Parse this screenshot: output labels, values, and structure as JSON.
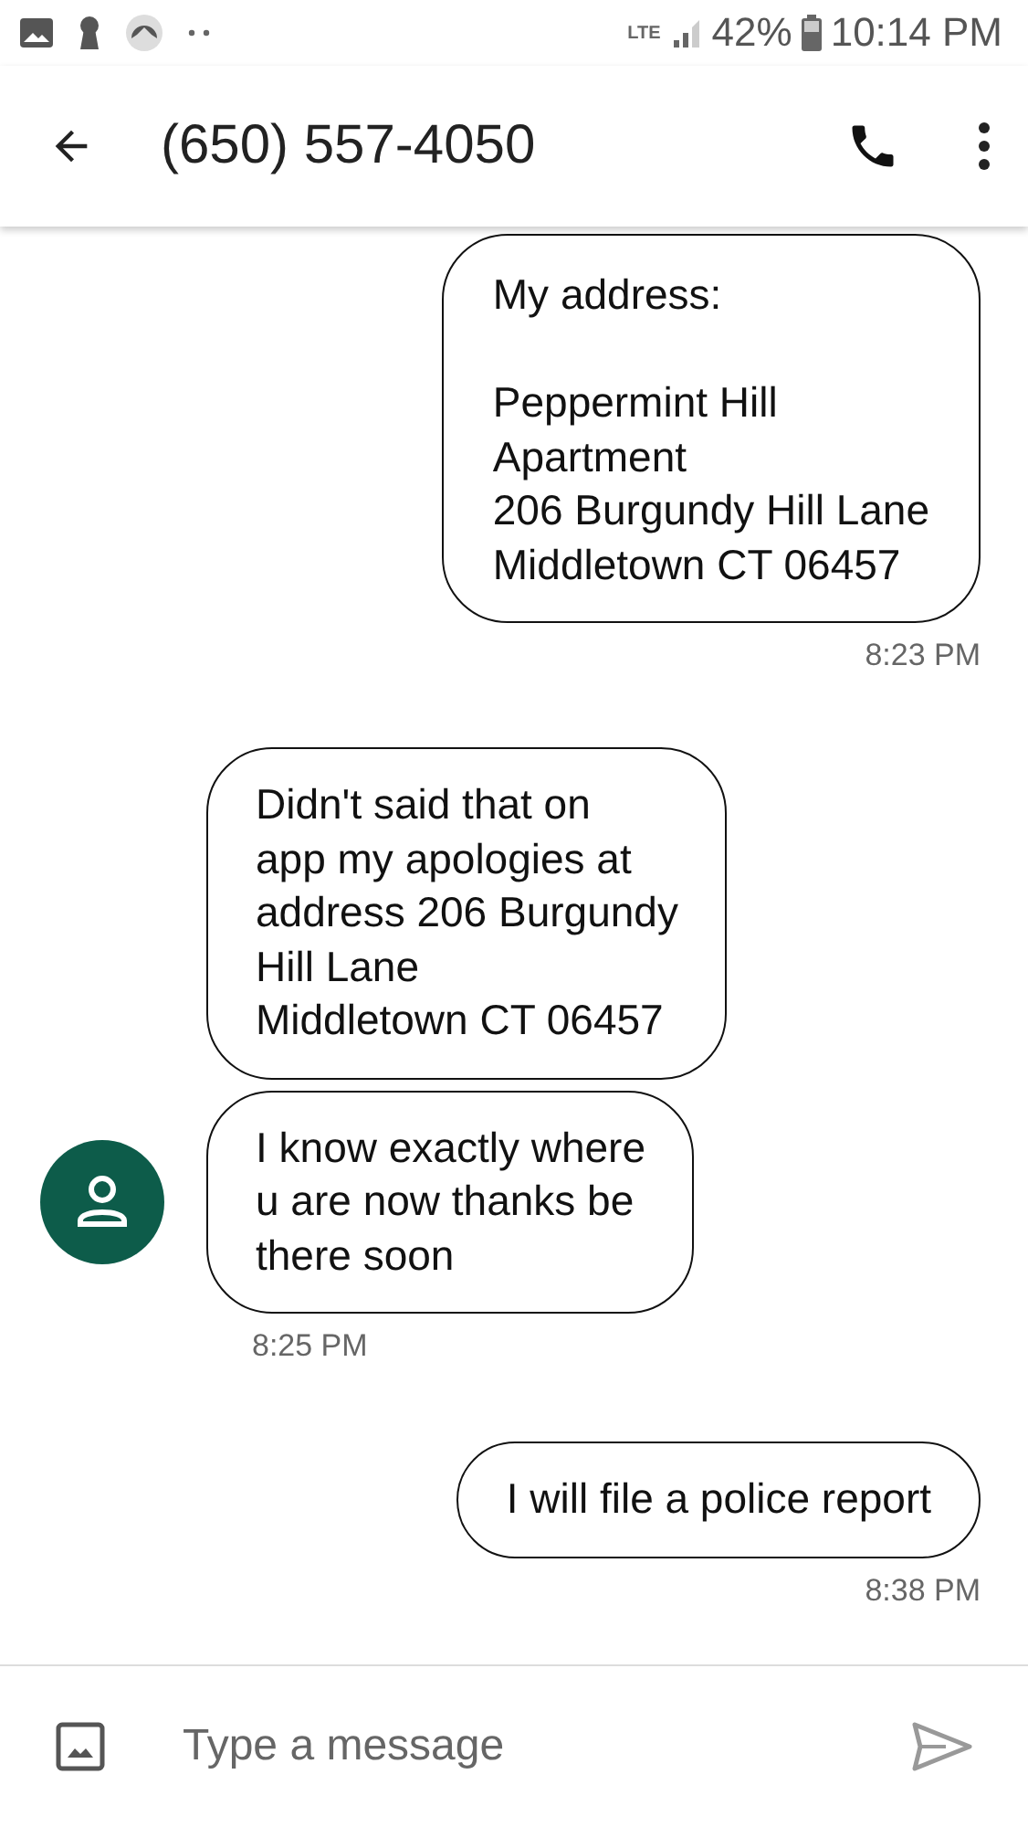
{
  "status_bar": {
    "network": "LTE",
    "battery": "42%",
    "time": "10:14 PM"
  },
  "app_bar": {
    "title": "(650) 557-4050"
  },
  "messages": [
    {
      "kind": "outgoing",
      "text": "My address:\n\nPeppermint Hill\nApartment\n206 Burgundy Hill Lane\nMiddletown CT 06457",
      "time": "8:23 PM"
    },
    {
      "kind": "incoming",
      "text": "Didn't said that on\napp my apologies at\naddress 206 Burgundy\nHill Lane\nMiddletown CT 06457",
      "show_avatar": false
    },
    {
      "kind": "incoming",
      "text": "I know exactly where\nu are now thanks be\nthere soon",
      "time": "8:25 PM",
      "show_avatar": true
    },
    {
      "kind": "outgoing",
      "text": "I will file a police report",
      "time": "8:38 PM"
    }
  ],
  "composer": {
    "placeholder": "Type a message"
  }
}
